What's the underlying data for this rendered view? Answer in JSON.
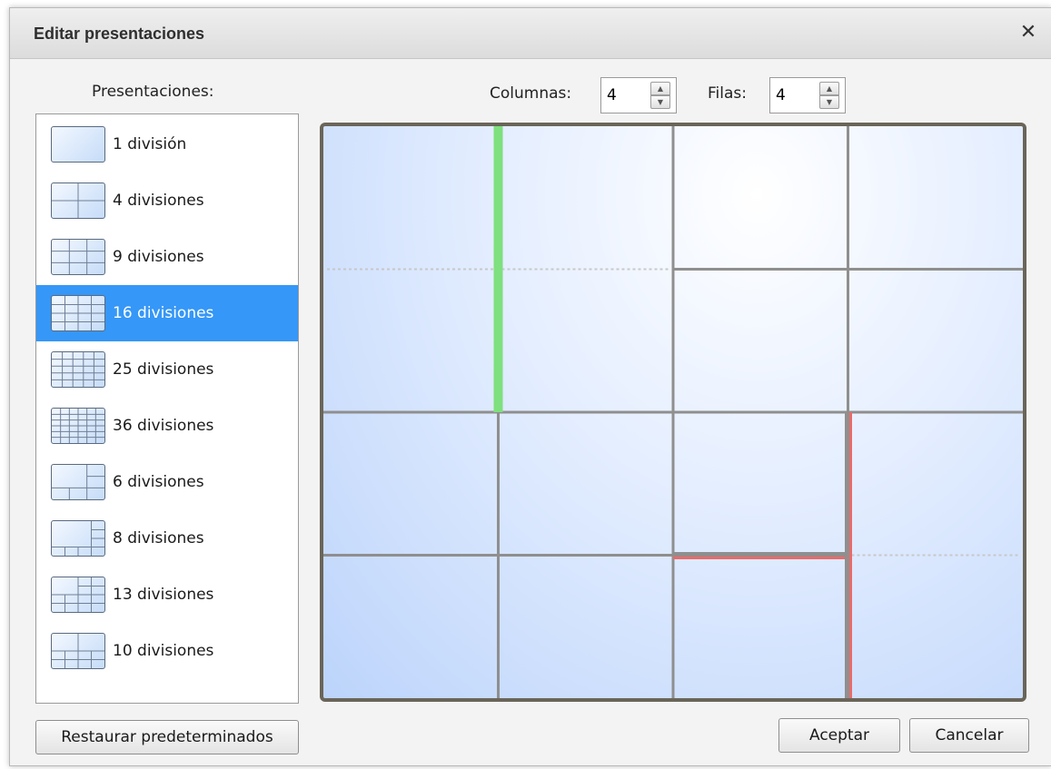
{
  "dialog": {
    "title": "Editar presentaciones",
    "close_icon": "close-icon"
  },
  "presets": {
    "label": "Presentaciones:",
    "selected_index": 3,
    "items": [
      {
        "label": "1 división",
        "cols": 1,
        "rows": 1
      },
      {
        "label": "4 divisiones",
        "cols": 2,
        "rows": 2
      },
      {
        "label": "9 divisiones",
        "cols": 3,
        "rows": 3
      },
      {
        "label": "16 divisiones",
        "cols": 4,
        "rows": 4
      },
      {
        "label": "25 divisiones",
        "cols": 5,
        "rows": 5
      },
      {
        "label": "36 divisiones",
        "cols": 6,
        "rows": 6
      },
      {
        "label": "6 divisiones",
        "cols": 3,
        "rows": 3
      },
      {
        "label": "8 divisiones",
        "cols": 4,
        "rows": 4
      },
      {
        "label": "13 divisiones",
        "cols": 4,
        "rows": 4
      },
      {
        "label": "10 divisiones",
        "cols": 4,
        "rows": 3
      }
    ],
    "restore_label": "Restaurar predeterminados"
  },
  "grid_controls": {
    "columns_label": "Columnas:",
    "columns_value": "4",
    "rows_label": "Filas:",
    "rows_value": "4"
  },
  "layout": {
    "cols": 4,
    "rows": 4,
    "merged_cells": [
      {
        "col": 0,
        "row": 0,
        "colspan": 2,
        "rowspan": 2
      },
      {
        "col": 3,
        "row": 2,
        "colspan": 1,
        "rowspan": 2
      }
    ],
    "green_handle": {
      "between_cols": 1,
      "row": 0,
      "rowspan": 2
    },
    "red_selection": {
      "col": 2,
      "row": 3,
      "border_sides": [
        "top",
        "right"
      ]
    }
  },
  "colors": {
    "selected_bg": "#3597f7",
    "divider": "#8f8f8f",
    "frame": "#6a6559",
    "green_handle": "#7ee07e",
    "red_selection": "#e86b6b"
  },
  "buttons": {
    "accept_label": "Aceptar",
    "cancel_label": "Cancelar"
  }
}
